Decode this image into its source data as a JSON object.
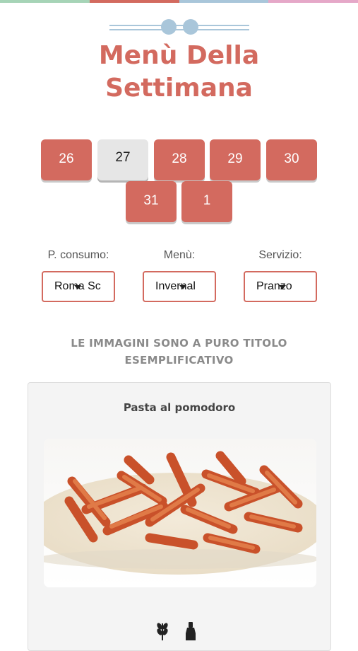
{
  "header": {
    "title_line1": "Menù Della",
    "title_line2": "Settimana"
  },
  "days": [
    {
      "label": "26",
      "active": false
    },
    {
      "label": "27",
      "active": true
    },
    {
      "label": "28",
      "active": false
    },
    {
      "label": "29",
      "active": false
    },
    {
      "label": "30",
      "active": false
    },
    {
      "label": "31",
      "active": false
    },
    {
      "label": "1",
      "active": false
    }
  ],
  "filters": {
    "consumo": {
      "label": "P. consumo:",
      "value": "Roma Sc"
    },
    "menu": {
      "label": "Menù:",
      "value": "Invernal"
    },
    "servizio": {
      "label": "Servizio:",
      "value": "Pranzo"
    }
  },
  "notice": {
    "line1": "LE IMMAGINI SONO A PURO TITOLO",
    "line2": "ESEMPLIFICATIVO"
  },
  "dish": {
    "name": "Pasta al pomodoro",
    "icons": [
      "wheat-icon",
      "bottle-icon"
    ]
  },
  "colors": {
    "accent": "#d36a5f",
    "active_day": "#e6e6e6",
    "decor": "#a9c6da"
  }
}
